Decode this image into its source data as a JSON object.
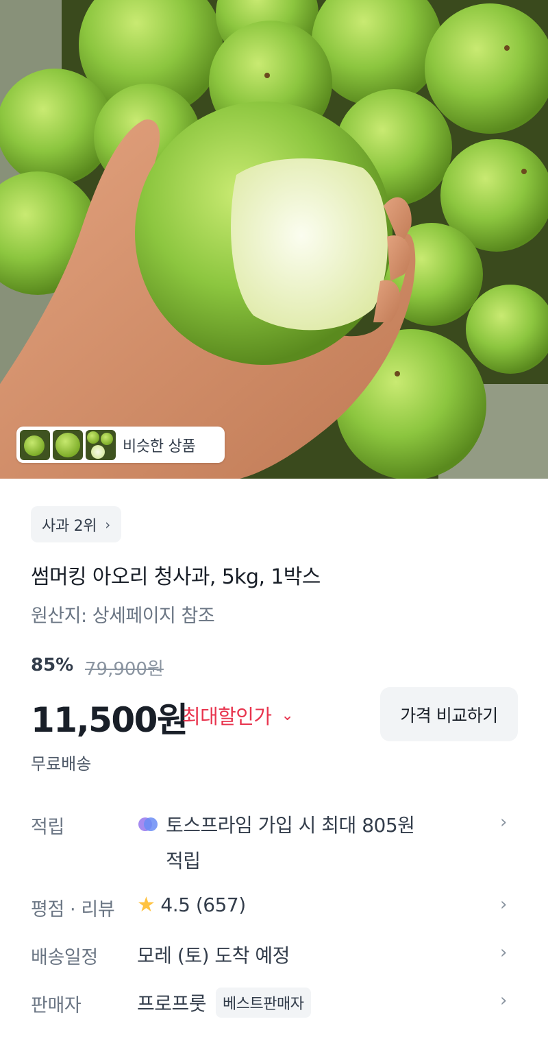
{
  "hero": {
    "similar_products_label": "비슷한 상품"
  },
  "category_rank": {
    "label": "사과 2위"
  },
  "product": {
    "title": "썸머킹 아오리 청사과, 5kg, 1박스",
    "origin": "원산지: 상세페이지 참조",
    "discount_percent": "85%",
    "original_price": "79,900원",
    "price": "11,500원",
    "max_discount_label": "최대할인가",
    "compare_button": "가격 비교하기",
    "shipping": "무료배송"
  },
  "details": {
    "reward": {
      "label": "적립",
      "value_line1": "토스프라임 가입 시 최대 805원",
      "value_line2": "적립"
    },
    "rating": {
      "label": "평점 · 리뷰",
      "value": "4.5 (657)"
    },
    "delivery": {
      "label": "배송일정",
      "value": "모레 (토) 도착 예정"
    },
    "seller": {
      "label": "판매자",
      "value": "프로프룻",
      "badge": "베스트판매자"
    }
  },
  "colors": {
    "accent_red": "#e8344e",
    "star": "#ffc342",
    "apple_green": "#8cc63f"
  }
}
